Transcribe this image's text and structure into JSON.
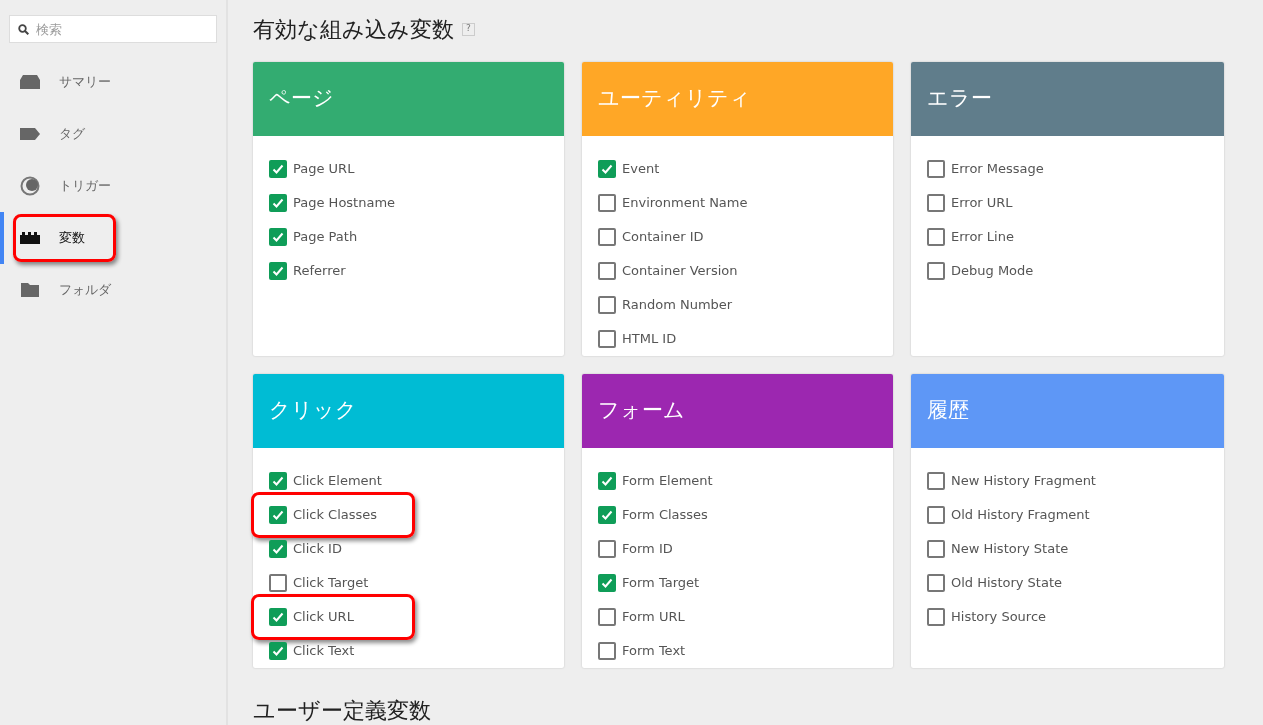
{
  "sidebar": {
    "search": {
      "placeholder": "検索"
    },
    "items": [
      {
        "label": "サマリー",
        "selected": false,
        "highlighted": false
      },
      {
        "label": "タグ",
        "selected": false,
        "highlighted": false
      },
      {
        "label": "トリガー",
        "selected": false,
        "highlighted": false
      },
      {
        "label": "変数",
        "selected": true,
        "highlighted": true
      },
      {
        "label": "フォルダ",
        "selected": false,
        "highlighted": false
      }
    ]
  },
  "main": {
    "title": "有効な組み込み変数",
    "help": "?",
    "cards": [
      {
        "title": "ページ",
        "color": "#33ac71",
        "items": [
          {
            "label": "Page URL",
            "checked": true,
            "highlighted": false
          },
          {
            "label": "Page Hostname",
            "checked": true,
            "highlighted": false
          },
          {
            "label": "Page Path",
            "checked": true,
            "highlighted": false
          },
          {
            "label": "Referrer",
            "checked": true,
            "highlighted": false
          }
        ]
      },
      {
        "title": "ユーティリティ",
        "color": "#ffa726",
        "items": [
          {
            "label": "Event",
            "checked": true,
            "highlighted": false
          },
          {
            "label": "Environment Name",
            "checked": false,
            "highlighted": false
          },
          {
            "label": "Container ID",
            "checked": false,
            "highlighted": false
          },
          {
            "label": "Container Version",
            "checked": false,
            "highlighted": false
          },
          {
            "label": "Random Number",
            "checked": false,
            "highlighted": false
          },
          {
            "label": "HTML ID",
            "checked": false,
            "highlighted": false
          }
        ]
      },
      {
        "title": "エラー",
        "color": "#607d8b",
        "items": [
          {
            "label": "Error Message",
            "checked": false,
            "highlighted": false
          },
          {
            "label": "Error URL",
            "checked": false,
            "highlighted": false
          },
          {
            "label": "Error Line",
            "checked": false,
            "highlighted": false
          },
          {
            "label": "Debug Mode",
            "checked": false,
            "highlighted": false
          }
        ]
      },
      {
        "title": "クリック",
        "color": "#00bcd4",
        "items": [
          {
            "label": "Click Element",
            "checked": true,
            "highlighted": false
          },
          {
            "label": "Click Classes",
            "checked": true,
            "highlighted": true
          },
          {
            "label": "Click ID",
            "checked": true,
            "highlighted": false
          },
          {
            "label": "Click Target",
            "checked": false,
            "highlighted": false
          },
          {
            "label": "Click URL",
            "checked": true,
            "highlighted": true
          },
          {
            "label": "Click Text",
            "checked": true,
            "highlighted": false
          }
        ]
      },
      {
        "title": "フォーム",
        "color": "#9c27b0",
        "items": [
          {
            "label": "Form Element",
            "checked": true,
            "highlighted": false
          },
          {
            "label": "Form Classes",
            "checked": true,
            "highlighted": false
          },
          {
            "label": "Form ID",
            "checked": false,
            "highlighted": false
          },
          {
            "label": "Form Target",
            "checked": true,
            "highlighted": false
          },
          {
            "label": "Form URL",
            "checked": false,
            "highlighted": false
          },
          {
            "label": "Form Text",
            "checked": false,
            "highlighted": false
          }
        ]
      },
      {
        "title": "履歴",
        "color": "#5e97f6",
        "items": [
          {
            "label": "New History Fragment",
            "checked": false,
            "highlighted": false
          },
          {
            "label": "Old History Fragment",
            "checked": false,
            "highlighted": false
          },
          {
            "label": "New History State",
            "checked": false,
            "highlighted": false
          },
          {
            "label": "Old History State",
            "checked": false,
            "highlighted": false
          },
          {
            "label": "History Source",
            "checked": false,
            "highlighted": false
          }
        ]
      }
    ],
    "section2_title": "ユーザー定義変数"
  }
}
